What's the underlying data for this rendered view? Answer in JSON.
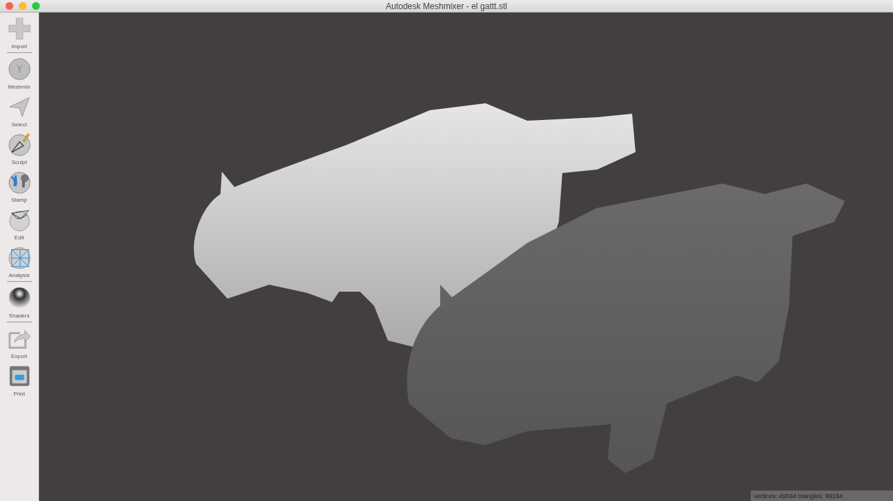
{
  "window": {
    "title": "Autodesk Meshmixer - el gattt.stl"
  },
  "toolbar": {
    "groups": [
      {
        "items": [
          {
            "label": "Import"
          }
        ]
      },
      {
        "items": [
          {
            "label": "Meshmix"
          },
          {
            "label": "Select"
          },
          {
            "label": "Sculpt"
          },
          {
            "label": "Stamp"
          },
          {
            "label": "Edit"
          },
          {
            "label": "Analysis"
          }
        ]
      },
      {
        "items": [
          {
            "label": "Shaders"
          }
        ]
      },
      {
        "items": [
          {
            "label": "Export"
          },
          {
            "label": "Print"
          }
        ]
      }
    ]
  },
  "status_bar": {
    "text": "vertices: 49594 triangles: 99184"
  }
}
